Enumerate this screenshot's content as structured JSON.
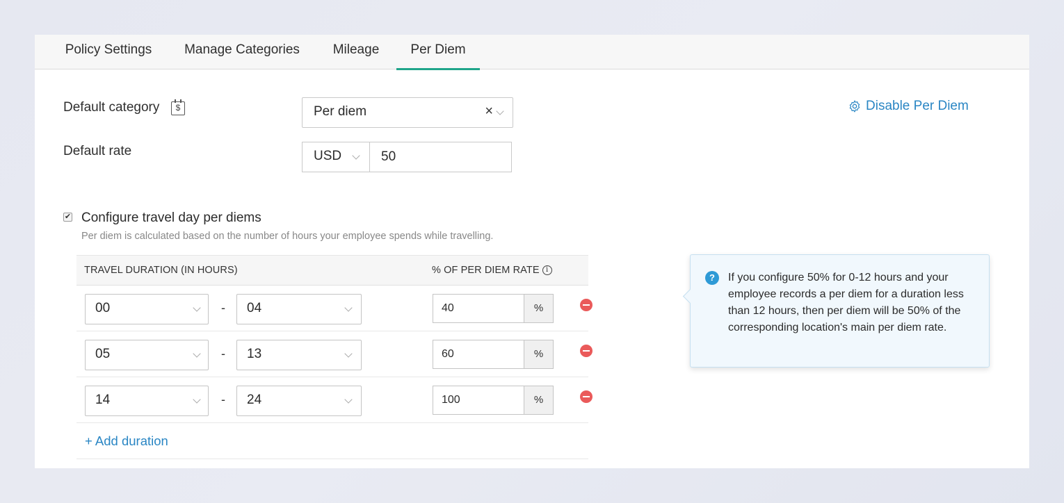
{
  "tabs": [
    {
      "label": "Policy Settings"
    },
    {
      "label": "Manage Categories"
    },
    {
      "label": "Mileage"
    },
    {
      "label": "Per Diem"
    }
  ],
  "active_tab": "Per Diem",
  "default_category": {
    "label": "Default category",
    "icon_text": "$",
    "value": "Per diem",
    "clear_icon": "×"
  },
  "default_rate": {
    "label": "Default rate",
    "currency": "USD",
    "amount": "50"
  },
  "disable_link": "Disable Per Diem",
  "travel_config": {
    "checked": true,
    "checkbox_mark": "✔",
    "title": "Configure travel day per diems",
    "description": "Per diem is calculated based on the number of hours your employee spends while travelling."
  },
  "table": {
    "col_duration": "TRAVEL DURATION (IN HOURS)",
    "col_rate": "% OF PER DIEM RATE",
    "info_glyph": "i",
    "separator": "-",
    "pct_symbol": "%",
    "rows": [
      {
        "from": "00",
        "to": "04",
        "pct": "40"
      },
      {
        "from": "05",
        "to": "13",
        "pct": "60"
      },
      {
        "from": "14",
        "to": "24",
        "pct": "100"
      }
    ]
  },
  "add_duration": "+ Add duration",
  "tooltip": {
    "icon": "?",
    "text": "If you configure 50% for 0-12 hours and your employee records a per diem for a duration less than 12 hours, then per diem will be 50% of the corresponding location's main per diem rate."
  },
  "colors": {
    "accent_tab": "#1fa58a",
    "link": "#2a86c4",
    "remove": "#ea5a5a",
    "help": "#2e9ad6"
  }
}
